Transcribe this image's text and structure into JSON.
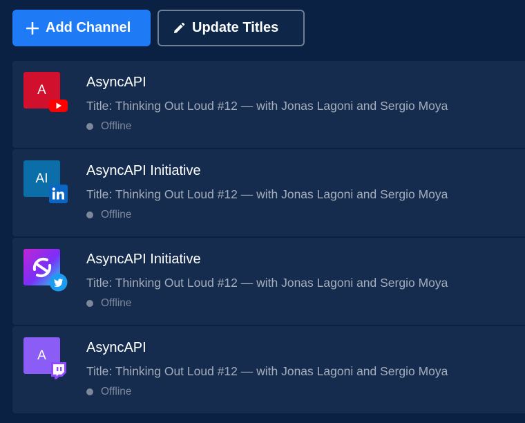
{
  "toolbar": {
    "add_channel_label": "Add Channel",
    "add_icon": "plus-icon",
    "update_titles_label": "Update Titles",
    "update_icon": "pencil-icon"
  },
  "colors": {
    "background": "#0a2143",
    "row_background": "#152c4f",
    "primary": "#1e7bf5"
  },
  "channels": [
    {
      "name": "AsyncAPI",
      "avatar_text": "A",
      "avatar_color": "#d1102e",
      "platform": "youtube",
      "platform_icon": "youtube-icon",
      "title": "Title: Thinking Out Loud #12 — with Jonas Lagoni and Sergio Moya",
      "status": "Offline"
    },
    {
      "name": "AsyncAPI Initiative",
      "avatar_text": "AI",
      "avatar_color": "#0b6ea8",
      "platform": "linkedin",
      "platform_icon": "linkedin-icon",
      "title": "Title: Thinking Out Loud #12 — with Jonas Lagoni and Sergio Moya",
      "status": "Offline"
    },
    {
      "name": "AsyncAPI Initiative",
      "avatar_text": "",
      "avatar_color": "#7b2ff7",
      "platform": "twitter",
      "platform_icon": "twitter-icon",
      "title": "Title: Thinking Out Loud #12 — with Jonas Lagoni and Sergio Moya",
      "status": "Offline"
    },
    {
      "name": "AsyncAPI",
      "avatar_text": "A",
      "avatar_color": "#8b5cf6",
      "platform": "twitch",
      "platform_icon": "twitch-icon",
      "title": "Title: Thinking Out Loud #12 — with Jonas Lagoni and Sergio Moya",
      "status": "Offline"
    }
  ]
}
